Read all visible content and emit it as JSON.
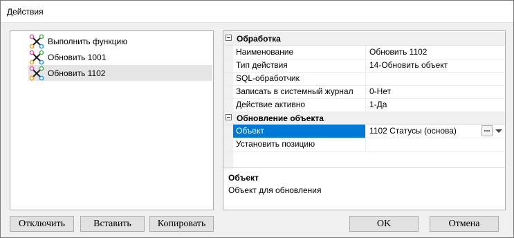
{
  "window": {
    "title": "Действия"
  },
  "tree": {
    "items": [
      {
        "label": "Выполнить функцию",
        "selected": false,
        "icon": "action-node-icon"
      },
      {
        "label": "Обновить 1001",
        "selected": false,
        "icon": "action-node-icon"
      },
      {
        "label": "Обновить 1102",
        "selected": true,
        "icon": "action-node-icon"
      }
    ]
  },
  "grid": {
    "categories": [
      {
        "label": "Обработка",
        "expanded": true,
        "properties": [
          {
            "name": "Наименование",
            "value": "Обновить 1102"
          },
          {
            "name": "Тип действия",
            "value": "14-Обновить объект"
          },
          {
            "name": "SQL-обработчик",
            "value": ""
          },
          {
            "name": "Записать в системный журнал",
            "value": "0-Нет"
          },
          {
            "name": "Действие активно",
            "value": "1-Да"
          }
        ]
      },
      {
        "label": "Обновление объекта",
        "expanded": true,
        "properties": [
          {
            "name": "Объект",
            "value": "1102 Статусы (основа)",
            "selected": true,
            "has_ellipsis": true,
            "ellipsis_label": "...",
            "has_dropdown": true
          },
          {
            "name": "Установить позицию",
            "value": ""
          }
        ]
      }
    ],
    "description": {
      "title": "Объект",
      "text": "Объект для обновления"
    }
  },
  "buttons": {
    "disable": "Отключить",
    "insert": "Вставить",
    "copy": "Копировать",
    "ok": "OK",
    "cancel": "Отмена"
  },
  "colors": {
    "selection": "#0078d7",
    "tree_selection": "#e5e5e5",
    "background": "#f0f0f0"
  }
}
